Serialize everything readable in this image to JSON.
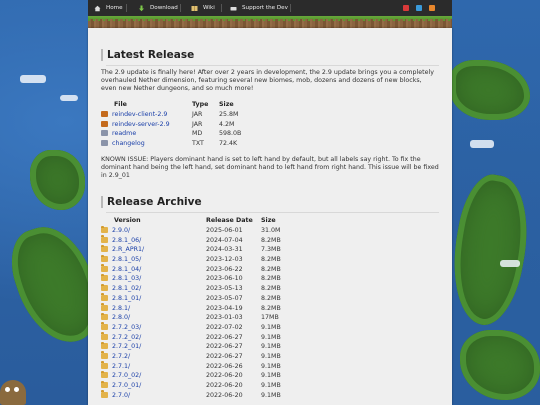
{
  "nav": {
    "items": [
      {
        "label": "Home",
        "icon": "home-icon"
      },
      {
        "label": "Download",
        "icon": "download-icon"
      },
      {
        "label": "Wiki",
        "icon": "book-icon"
      },
      {
        "label": "Support the Dev",
        "icon": "heart-icon"
      }
    ],
    "social": [
      "youtube-icon",
      "twitter-icon",
      "rss-icon"
    ]
  },
  "latest": {
    "title": "Latest Release",
    "intro": "The 2.9 update is finally here! After over 2 years in development, the 2.9 update brings you a completely overhauled Nether dimension, featuring several new biomes, mob, dozens and dozens of new blocks, even new Nether dungeons, and so much more!",
    "headers": [
      "File",
      "Type",
      "Size"
    ],
    "files": [
      {
        "name": "reindev-client-2.9",
        "type": "JAR",
        "size": "25.8M",
        "icon": "jar"
      },
      {
        "name": "reindev-server-2.9",
        "type": "JAR",
        "size": "4.2M",
        "icon": "jar"
      },
      {
        "name": "readme",
        "type": "MD",
        "size": "598.0B",
        "icon": "doc"
      },
      {
        "name": "changelog",
        "type": "TXT",
        "size": "72.4K",
        "icon": "doc"
      }
    ],
    "notice": "KNOWN ISSUE: Players dominant hand is set to left hand by default, but all labels say right. To fix the dominant hand being the left hand, set dominant hand to left hand from right hand. This issue will be fixed in 2.9_01"
  },
  "archive": {
    "title": "Release Archive",
    "headers": [
      "Version",
      "Release Date",
      "Size"
    ],
    "rows": [
      {
        "version": "2.9.0/",
        "date": "2025-06-01",
        "size": "31.0M"
      },
      {
        "version": "2.8.1_06/",
        "date": "2024-07-04",
        "size": "8.2MB"
      },
      {
        "version": "2.R_APR1/",
        "date": "2024-03-31",
        "size": "7.3MB"
      },
      {
        "version": "2.8.1_05/",
        "date": "2023-12-03",
        "size": "8.2MB"
      },
      {
        "version": "2.8.1_04/",
        "date": "2023-06-22",
        "size": "8.2MB"
      },
      {
        "version": "2.8.1_03/",
        "date": "2023-06-10",
        "size": "8.2MB"
      },
      {
        "version": "2.8.1_02/",
        "date": "2023-05-13",
        "size": "8.2MB"
      },
      {
        "version": "2.8.1_01/",
        "date": "2023-05-07",
        "size": "8.2MB"
      },
      {
        "version": "2.8.1/",
        "date": "2023-04-19",
        "size": "8.2MB"
      },
      {
        "version": "2.8.0/",
        "date": "2023-01-03",
        "size": "17MB"
      },
      {
        "version": "2.7.2_03/",
        "date": "2022-07-02",
        "size": "9.1MB"
      },
      {
        "version": "2.7.2_02/",
        "date": "2022-06-27",
        "size": "9.1MB"
      },
      {
        "version": "2.7.2_01/",
        "date": "2022-06-27",
        "size": "9.1MB"
      },
      {
        "version": "2.7.2/",
        "date": "2022-06-27",
        "size": "9.1MB"
      },
      {
        "version": "2.7.1/",
        "date": "2022-06-26",
        "size": "9.1MB"
      },
      {
        "version": "2.7.0_02/",
        "date": "2022-06-20",
        "size": "9.1MB"
      },
      {
        "version": "2.7.0_01/",
        "date": "2022-06-20",
        "size": "9.1MB"
      },
      {
        "version": "2.7.0/",
        "date": "2022-06-20",
        "size": "9.1MB"
      }
    ]
  }
}
